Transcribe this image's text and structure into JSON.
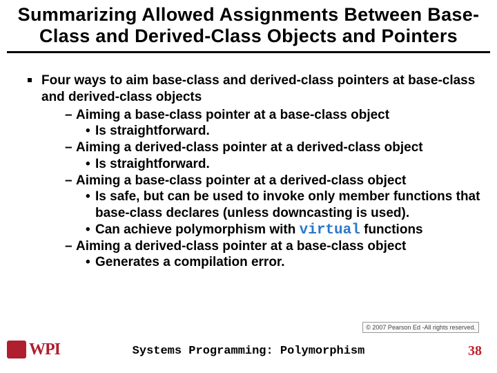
{
  "title_line1": "Summarizing Allowed Assignments Between Base-",
  "title_line2": "Class and Derived-Class Objects and Pointers",
  "main_intro": "Four ways to aim base-class and derived-class pointers at base-class and derived-class objects",
  "item1": "Aiming a base-class pointer at a base-class object",
  "item1_sub1": "Is straightforward.",
  "item2": "Aiming a derived-class pointer at a derived-class object",
  "item2_sub1": "Is straightforward.",
  "item3": "Aiming a base-class pointer at a derived-class object",
  "item3_sub1": "Is safe, but can be used to invoke only member functions that base-class declares (unless downcasting is used).",
  "item3_sub2_pre": "Can achieve polymorphism with ",
  "item3_sub2_kw": "virtual",
  "item3_sub2_post": " functions",
  "item4": "Aiming a derived-class pointer at a base-class object",
  "item4_sub1": "Generates a compilation error.",
  "copyright": "© 2007 Pearson Ed -All rights reserved.",
  "logo_text": "WPI",
  "footer_title": "Systems Programming:  Polymorphism",
  "page_number": "38"
}
